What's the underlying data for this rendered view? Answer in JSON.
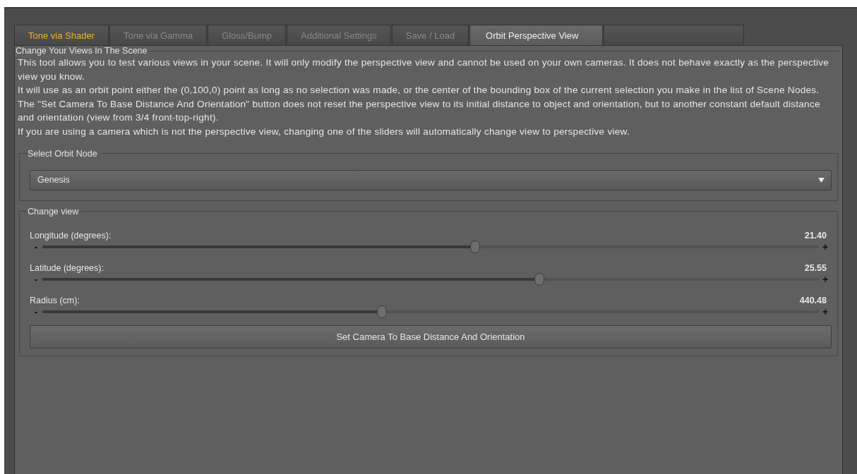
{
  "tabs": [
    {
      "label": "Tone via Shader",
      "selected": false,
      "highlighted": true
    },
    {
      "label": "Tone via Gamma",
      "selected": false,
      "highlighted": false
    },
    {
      "label": "Gloss/Bump",
      "selected": false,
      "highlighted": false
    },
    {
      "label": "Additional Settings",
      "selected": false,
      "highlighted": false
    },
    {
      "label": "Save / Load",
      "selected": false,
      "highlighted": false
    },
    {
      "label": "Orbit Perspective View",
      "selected": true,
      "highlighted": false
    }
  ],
  "intro": {
    "title": "Change Your Views In The Scene",
    "paragraphs": [
      "This tool allows you to test various views in your scene. It will only modify the perspective view and cannot be used on your own cameras. It does not behave exactly as the perspective view you know.",
      "It will use as an orbit point either the (0,100,0) point as long as no selection was made, or the center of the bounding box of the current selection you make in the list of Scene Nodes.",
      "The \"Set Camera To Base Distance And Orientation\" button does not reset the perspective view to its initial distance to object and orientation, but to another constant default distance and orientation (view from 3/4 front-top-right).",
      "If you are using a camera which is not the perspective view, changing one of the sliders will automatically change view to perspective view."
    ]
  },
  "orbit_node": {
    "title": "Select Orbit Node",
    "value": "Genesis"
  },
  "change_view": {
    "title": "Change view",
    "sliders": [
      {
        "label": "Longitude (degrees):",
        "reading": "21.40",
        "level": 0.557,
        "minus": "-",
        "plus": "+"
      },
      {
        "label": "Latitude (degrees):",
        "reading": "25.55",
        "level": 0.64,
        "minus": "-",
        "plus": "+"
      },
      {
        "label": "Radius (cm):",
        "reading": "440.48",
        "level": 0.4375,
        "minus": "-",
        "plus": "+"
      }
    ],
    "button": "Set Camera To Base Distance And Orientation"
  }
}
